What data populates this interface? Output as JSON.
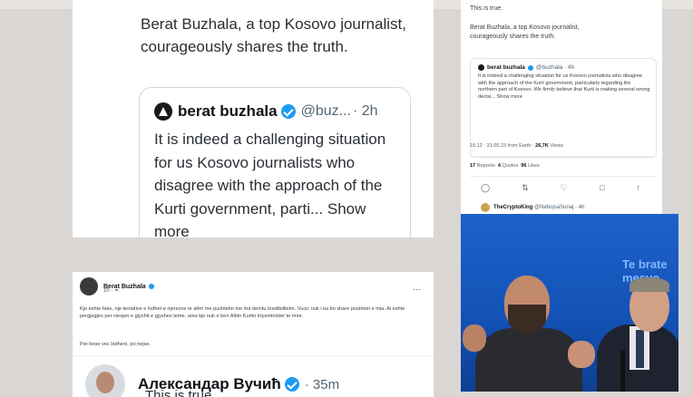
{
  "main_card": {
    "text": "Berat Buzhala, a top Kosovo journalist, courageously shares the truth.",
    "quoted": {
      "name": "berat buzhala",
      "handle": "@buz...",
      "time": "· 2h",
      "text": "It is indeed a challenging situation for us Kosovo journalists who disagree with the approach of the Kurti government, parti...",
      "show_more": "Show more"
    }
  },
  "right_card": {
    "line1": "This is true.",
    "line2": "Berat Buzhala, a top Kosovo journalist, courageously shares the truth.",
    "quoted": {
      "name": "berat buzhala",
      "handle": "@buzhala · 4h",
      "text": "It is indeed a challenging situation for us Kosovo journalists who disagree with the approach of the Kurti government, particularly regarding the northern part of Kosovo. We firmly believe that Kurti is making several wrong decisi... Show more"
    },
    "meta": "15:12 · 31.05.23 from Earth ·",
    "views_count": "26,7K",
    "views_label": "Views",
    "reposts_count": "17",
    "reposts_label": "Reposts",
    "quotes_count": "4",
    "quotes_label": "Quotes",
    "likes_count": "96",
    "likes_label": "Likes",
    "reply_name": "TheCryptoKing",
    "reply_handle": "@NebojsaSunaj · 4h"
  },
  "photo": {
    "overlay_text": "Te brate mesvo"
  },
  "bottom_card": {
    "name": "Berat Buzhala",
    "time": "1h · ⚭",
    "text": "Kjo eshte fake, nje tentative e lodhet e njerezve te aferi me pushtetin me ma demtu kredibilitetin. Vucic nuk i ka bo share postimet e mia. Ai eshte pergjegjes per viesjen e gjyshit e gjyshes teme, ama kjo nuk e ben Albin Kurtin kryeminister te mire.",
    "text2": "Per bese vec lodheni, po nejse.",
    "reply": {
      "name": "Александар Вучић",
      "time": "· 35m",
      "text": "This is true."
    }
  }
}
